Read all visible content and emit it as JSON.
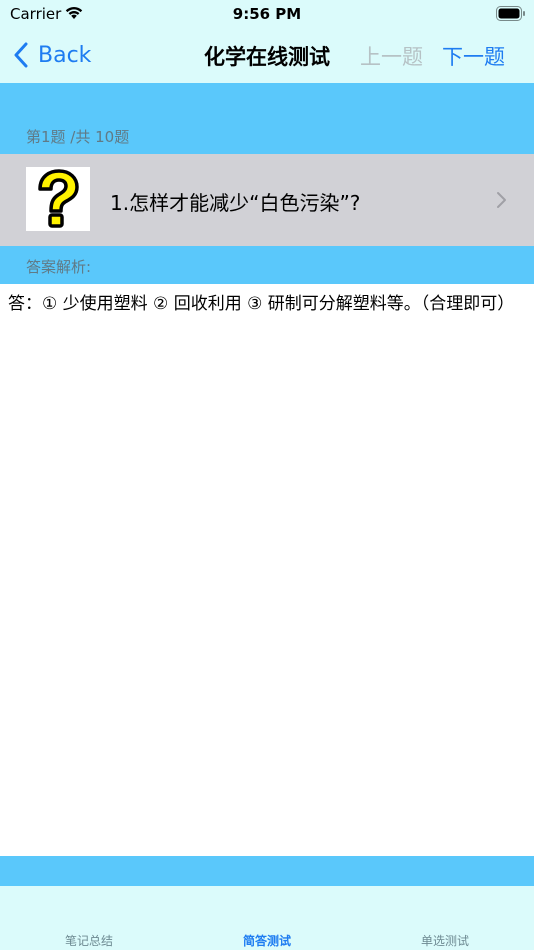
{
  "status_bar": {
    "carrier": "Carrier",
    "time": "9:56 PM"
  },
  "nav": {
    "back_label": "Back",
    "title": "化学在线测试",
    "prev_label": "上一题",
    "next_label": "下一题"
  },
  "question": {
    "counter": "第1题 /共 10题",
    "text": "1.怎样才能减少“白色污染”?"
  },
  "answer": {
    "label": "答案解析:",
    "text": "答：① 少使用塑料 ② 回收利用 ③ 研制可分解塑料等。（合理即可）"
  },
  "tabs": [
    {
      "label": "笔记总结",
      "active": false
    },
    {
      "label": "简答测试",
      "active": true
    },
    {
      "label": "单选测试",
      "active": false
    }
  ],
  "colors": {
    "accent": "#1e7cf1",
    "header_bg": "#dbfbfb",
    "band_blue": "#5ac8fb",
    "row_gray": "#d1d1d6",
    "disabled": "#b6c2c5"
  }
}
